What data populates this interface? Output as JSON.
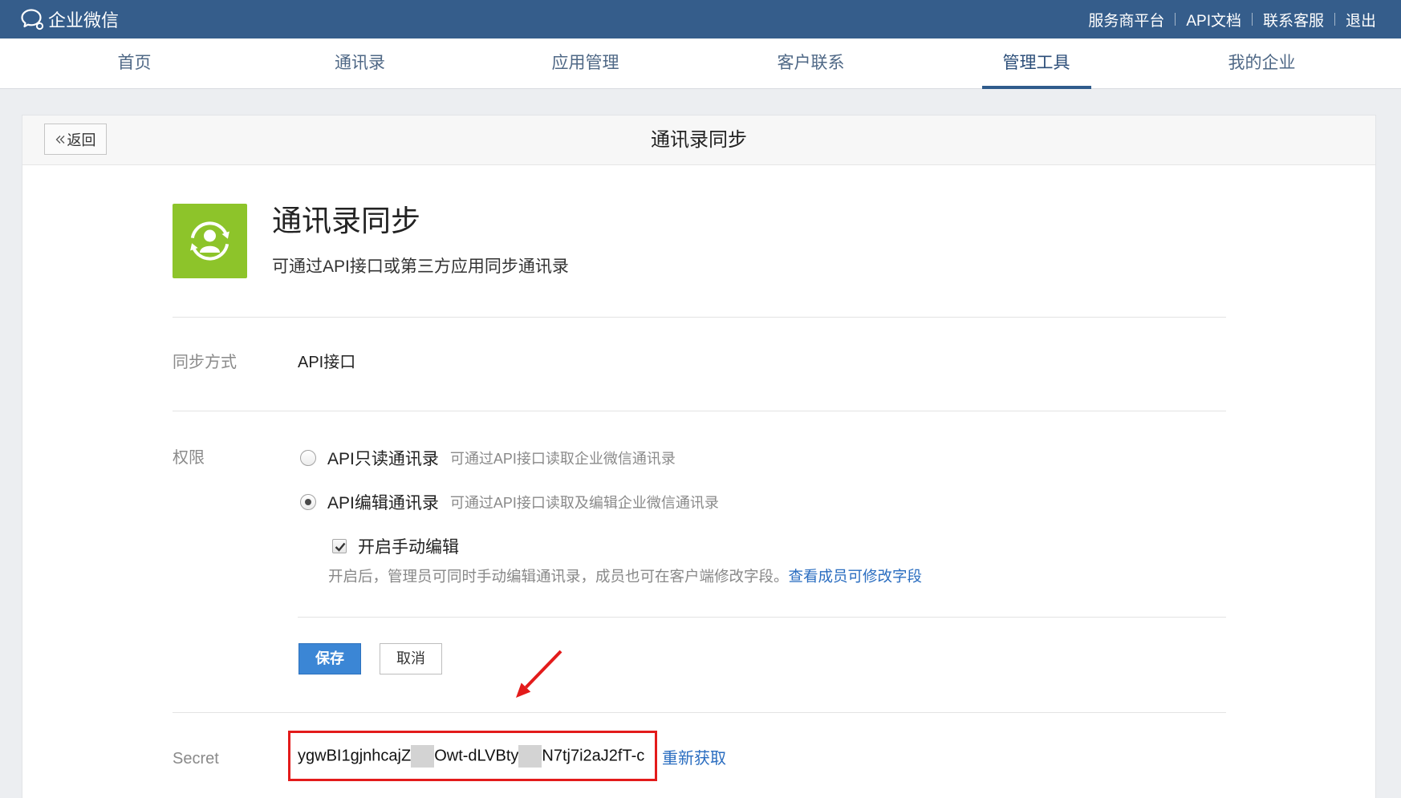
{
  "colors": {
    "topbar": "#355d8b",
    "app_icon": "#8dc42a",
    "primary": "#3b86d5",
    "link": "#2a6dc0",
    "highlight": "#e31b1b"
  },
  "topbar": {
    "logo_icon": "chat-bubble-logo-icon",
    "logo_text": "企业微信",
    "links": [
      "服务商平台",
      "API文档",
      "联系客服",
      "退出"
    ]
  },
  "nav": {
    "items": [
      "首页",
      "通讯录",
      "应用管理",
      "客户联系",
      "管理工具",
      "我的企业"
    ],
    "active_index": 4
  },
  "card": {
    "back_label": "返回",
    "title": "通讯录同步"
  },
  "app": {
    "icon": "contact-sync-icon",
    "title": "通讯录同步",
    "subtitle": "可通过API接口或第三方应用同步通讯录"
  },
  "sync_method": {
    "label": "同步方式",
    "value": "API接口"
  },
  "permission": {
    "label": "权限",
    "options": [
      {
        "label": "API只读通讯录",
        "desc": "可通过API接口读取企业微信通讯录",
        "checked": false
      },
      {
        "label": "API编辑通讯录",
        "desc": "可通过API接口读取及编辑企业微信通讯录",
        "checked": true
      }
    ],
    "manual_edit": {
      "label": "开启手动编辑",
      "checked": true,
      "note": "开启后，管理员可同时手动编辑通讯录，成员也可在客户端修改字段。",
      "link": "查看成员可修改字段"
    }
  },
  "actions": {
    "save": "保存",
    "cancel": "取消"
  },
  "secret": {
    "label": "Secret",
    "parts": [
      "ygwBI1gjnhcajZ",
      "Owt-dLVBty",
      "N7tj7i2aJ2fT-c"
    ],
    "refresh": "重新获取"
  }
}
